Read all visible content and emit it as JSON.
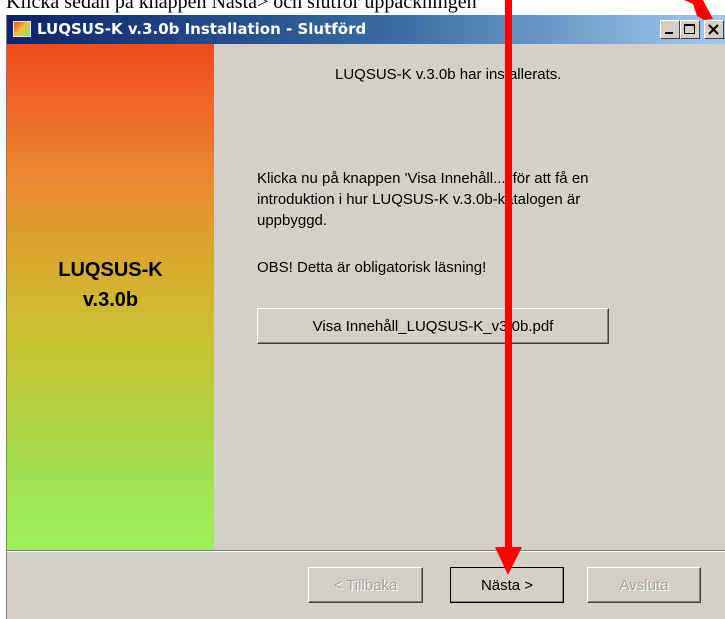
{
  "document": {
    "fragment_text": "Klicka sedan på knappen Nästa> och slutför uppackningen"
  },
  "window": {
    "title": "LUQSUS-K v.3.0b Installation - Slutförd",
    "controls": [
      "minimize-icon",
      "maximize-icon",
      "close-icon"
    ]
  },
  "sidebar": {
    "line1": "LUQSUS-K",
    "line2": "v.3.0b"
  },
  "content": {
    "installed_message": "LUQSUS-K v.3.0b har installerats.",
    "instruction_line1": "Klicka nu på knappen 'Visa Innehåll...' för att få en",
    "instruction_line2": "introduktion i hur LUQSUS-K v.3.0b-katalogen är",
    "instruction_line3": "uppbyggd.",
    "obs_text": "OBS! Detta är obligatorisk läsning!",
    "view_button_label": "Visa Innehåll_LUQSUS-K_v3.0b.pdf"
  },
  "footer": {
    "back_label": "< Tillbaka",
    "next_label": "Nästa >",
    "exit_label": "Avsluta"
  },
  "annotation": {
    "arrow_color": "#ff0000"
  }
}
